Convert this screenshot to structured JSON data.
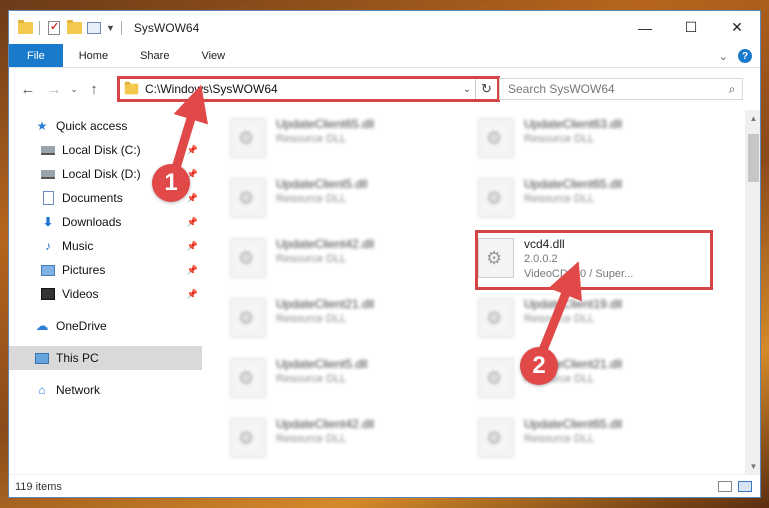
{
  "window": {
    "title": "SysWOW64",
    "controls": {
      "minimize": "—",
      "maximize": "☐",
      "close": "✕"
    }
  },
  "ribbon": {
    "tabs": [
      {
        "label": "File"
      },
      {
        "label": "Home"
      },
      {
        "label": "Share"
      },
      {
        "label": "View"
      }
    ],
    "help": "?",
    "collapse": "⌄"
  },
  "nav": {
    "back": "←",
    "forward": "→",
    "recent": "⌄",
    "up": "↑"
  },
  "address": {
    "path": "C:\\Windows\\SysWOW64",
    "caret": "⌄",
    "refresh": "↻"
  },
  "search": {
    "placeholder": "Search SysWOW64",
    "icon": "⌕"
  },
  "sidebar": {
    "items": [
      {
        "label": "Quick access",
        "icon": "star-icon",
        "pinned": false
      },
      {
        "label": "Local Disk (C:)",
        "icon": "drive-icon",
        "pinned": true
      },
      {
        "label": "Local Disk (D:)",
        "icon": "drive-icon",
        "pinned": true
      },
      {
        "label": "Documents",
        "icon": "document-icon",
        "pinned": true
      },
      {
        "label": "Downloads",
        "icon": "download-icon",
        "pinned": true
      },
      {
        "label": "Music",
        "icon": "music-icon",
        "pinned": true
      },
      {
        "label": "Pictures",
        "icon": "picture-icon",
        "pinned": true
      },
      {
        "label": "Videos",
        "icon": "video-icon",
        "pinned": true
      },
      {
        "label": "OneDrive",
        "icon": "cloud-icon",
        "pinned": false
      },
      {
        "label": "This PC",
        "icon": "computer-icon",
        "pinned": false,
        "selected": true
      },
      {
        "label": "Network",
        "icon": "network-icon",
        "pinned": false
      }
    ],
    "pin_glyph": "📌"
  },
  "files": {
    "left": [
      {
        "name": "UpdateClient65.dll",
        "sub": "Resource DLL"
      },
      {
        "name": "UpdateClient5.dll",
        "sub": "Resource DLL"
      },
      {
        "name": "UpdateClient42.dll",
        "sub": "Resource DLL"
      },
      {
        "name": "UpdateClient21.dll",
        "sub": "Resource DLL"
      },
      {
        "name": "UpdateClient5.dll",
        "sub": "Resource DLL"
      },
      {
        "name": "UpdateClient42.dll",
        "sub": "Resource DLL"
      }
    ],
    "right": [
      {
        "name": "UpdateClient63.dll",
        "sub": "Resource DLL"
      },
      {
        "name": "UpdateClient65.dll",
        "sub": "Resource DLL"
      },
      {
        "name": "UpdateClient19.dll",
        "sub": "Resource DLL"
      },
      {
        "name": "UpdateClient21.dll",
        "sub": "Resource DLL"
      },
      {
        "name": "UpdateClient65.dll",
        "sub": "Resource DLL"
      }
    ],
    "highlighted": {
      "name": "vcd4.dll",
      "version": "2.0.0.2",
      "description": "VideoCD 2.0 / Super..."
    }
  },
  "status": {
    "item_count": "119 items"
  },
  "annotations": {
    "badge1": "1",
    "badge2": "2",
    "color": "#e14848"
  },
  "colors": {
    "accent": "#1979ca",
    "highlight": "#d64545"
  }
}
